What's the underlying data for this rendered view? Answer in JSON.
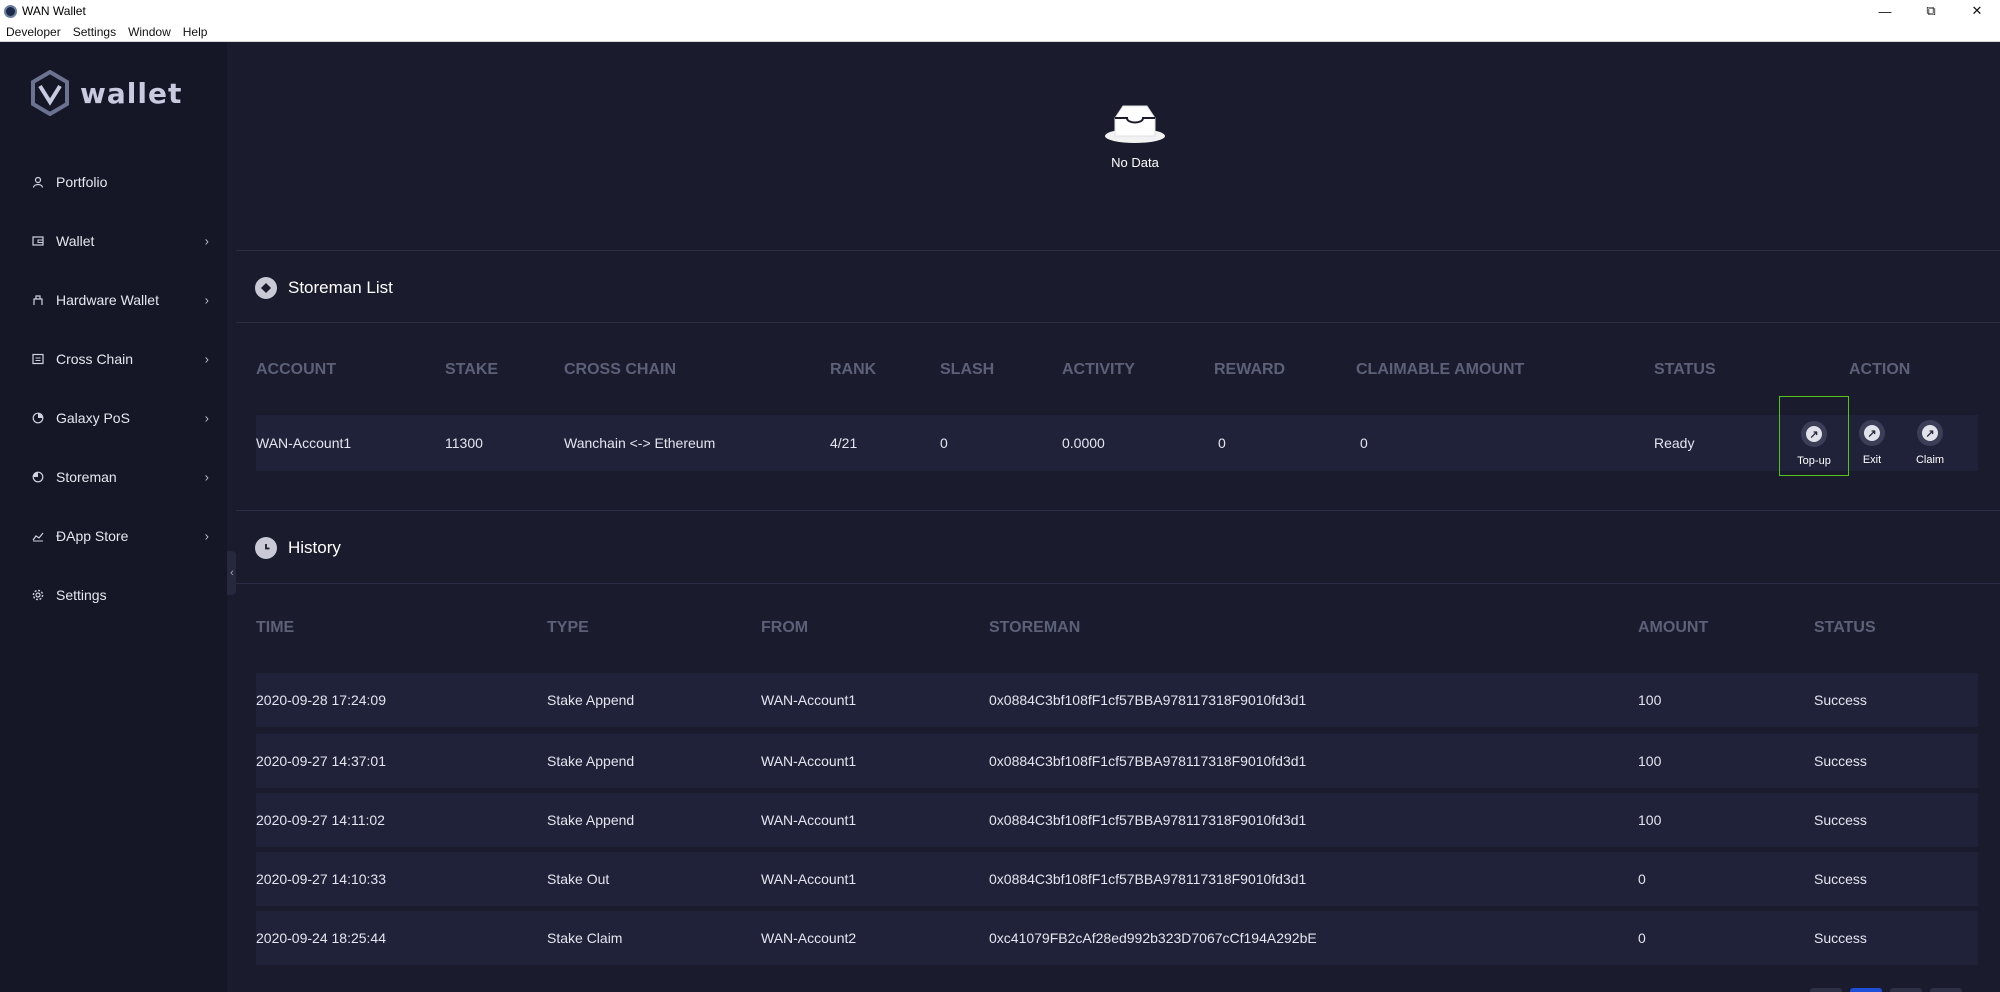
{
  "window": {
    "title": "WAN Wallet"
  },
  "menubar": [
    "Developer",
    "Settings",
    "Window",
    "Help"
  ],
  "logo": {
    "text": "wallet"
  },
  "sidebar": {
    "items": [
      {
        "label": "Portfolio",
        "icon": "user-icon",
        "has_chevron": false
      },
      {
        "label": "Wallet",
        "icon": "wallet-icon",
        "has_chevron": true
      },
      {
        "label": "Hardware Wallet",
        "icon": "hardware-icon",
        "has_chevron": true
      },
      {
        "label": "Cross Chain",
        "icon": "cross-chain-icon",
        "has_chevron": true
      },
      {
        "label": "Galaxy PoS",
        "icon": "pos-icon",
        "has_chevron": true
      },
      {
        "label": "Storeman",
        "icon": "storeman-icon",
        "has_chevron": true
      },
      {
        "label": "ĐApp Store",
        "icon": "chart-icon",
        "has_chevron": true
      },
      {
        "label": "Settings",
        "icon": "gear-icon",
        "has_chevron": false
      }
    ]
  },
  "empty_state": {
    "text": "No Data"
  },
  "storeman_list": {
    "title": "Storeman List",
    "columns": [
      "ACCOUNT",
      "STAKE",
      "CROSS CHAIN",
      "RANK",
      "SLASH",
      "ACTIVITY",
      "REWARD",
      "CLAIMABLE AMOUNT",
      "STATUS",
      "ACTION"
    ],
    "rows": [
      {
        "account": "WAN-Account1",
        "stake": "11300",
        "cross_chain": "Wanchain <-> Ethereum",
        "rank": "4/21",
        "slash": "0",
        "activity": "0.0000",
        "reward": "0",
        "claimable": "0",
        "status": "Ready"
      }
    ],
    "actions": [
      "Top-up",
      "Exit",
      "Claim"
    ]
  },
  "history": {
    "title": "History",
    "columns": [
      "TIME",
      "TYPE",
      "FROM",
      "STOREMAN",
      "AMOUNT",
      "STATUS"
    ],
    "rows": [
      {
        "time": "2020-09-28 17:24:09",
        "type": "Stake Append",
        "from": "WAN-Account1",
        "storeman": "0x0884C3bf108fF1cf57BBA978117318F9010fd3d1",
        "amount": "100",
        "status": "Success"
      },
      {
        "time": "2020-09-27 14:37:01",
        "type": "Stake Append",
        "from": "WAN-Account1",
        "storeman": "0x0884C3bf108fF1cf57BBA978117318F9010fd3d1",
        "amount": "100",
        "status": "Success"
      },
      {
        "time": "2020-09-27 14:11:02",
        "type": "Stake Append",
        "from": "WAN-Account1",
        "storeman": "0x0884C3bf108fF1cf57BBA978117318F9010fd3d1",
        "amount": "100",
        "status": "Success"
      },
      {
        "time": "2020-09-27 14:10:33",
        "type": "Stake Out",
        "from": "WAN-Account1",
        "storeman": "0x0884C3bf108fF1cf57BBA978117318F9010fd3d1",
        "amount": "0",
        "status": "Success"
      },
      {
        "time": "2020-09-24 18:25:44",
        "type": "Stake Claim",
        "from": "WAN-Account2",
        "storeman": "0xc41079FB2cAf28ed992b323D7067cCf194A292bE",
        "amount": "0",
        "status": "Success"
      }
    ]
  },
  "colors": {
    "background": "#1a1c2e",
    "sidebar": "#151727",
    "row": "#20223a",
    "header_text": "#5c6078",
    "highlight": "#52c41a"
  }
}
